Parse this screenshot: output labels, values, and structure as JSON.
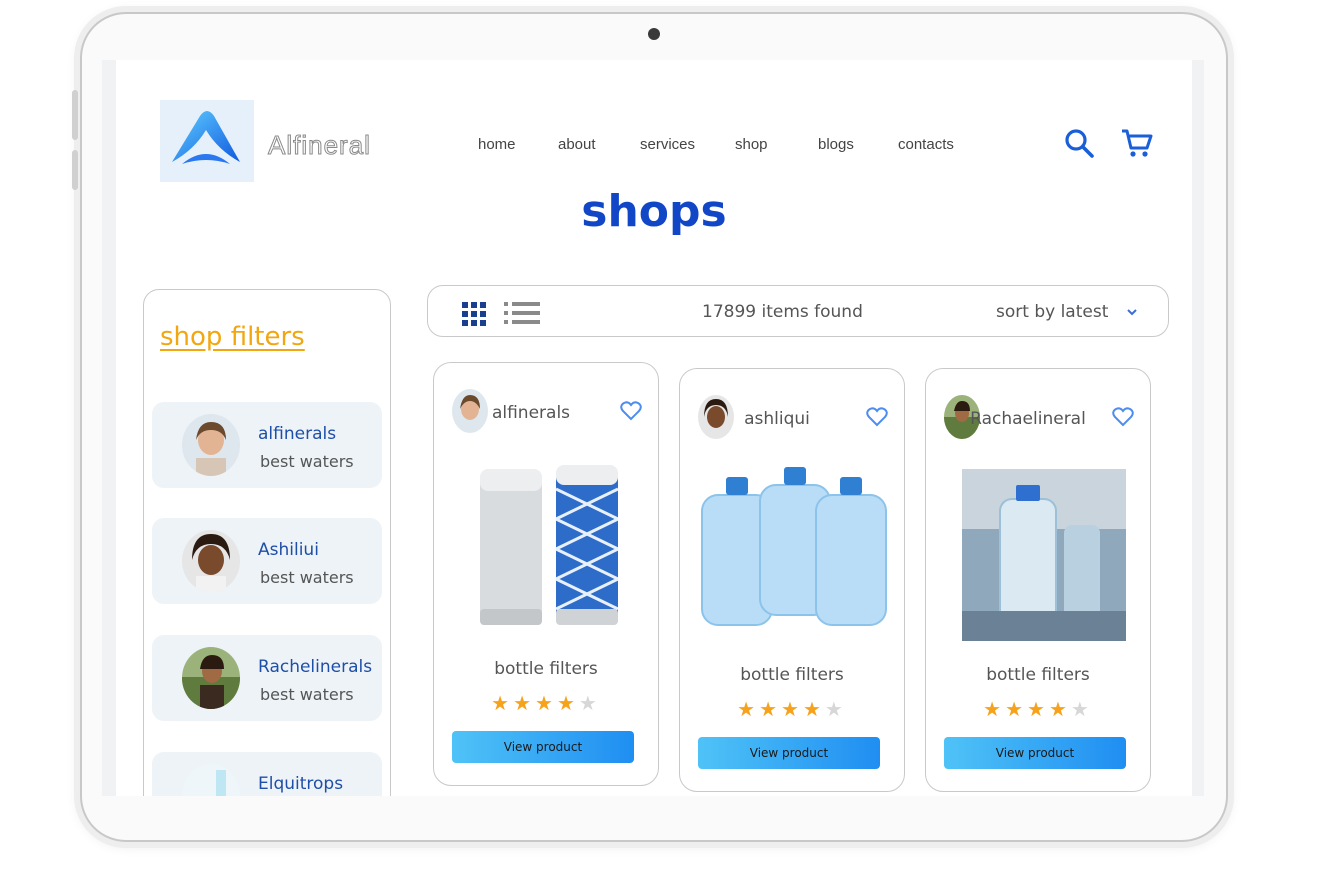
{
  "header": {
    "brand": "Alfineral",
    "nav": [
      {
        "label": "home"
      },
      {
        "label": "about"
      },
      {
        "label": "services"
      },
      {
        "label": "shop"
      },
      {
        "label": "blogs"
      },
      {
        "label": "contacts"
      }
    ],
    "icons": [
      "search-icon",
      "cart-icon"
    ],
    "accent_color": "#1147c7"
  },
  "page": {
    "title": "shops"
  },
  "sidebar": {
    "title": "shop filters",
    "items": [
      {
        "name": "alfinerals",
        "subtitle": "best waters"
      },
      {
        "name": "Ashiliui",
        "subtitle": "best waters"
      },
      {
        "name": "Rachelinerals",
        "subtitle": "best waters"
      },
      {
        "name": "Elquitrops",
        "subtitle": ""
      }
    ]
  },
  "toolbar": {
    "count_text": "17899 items found",
    "sort_label": "sort by latest",
    "view_modes": [
      "grid-view-icon",
      "list-view-icon"
    ]
  },
  "products": [
    {
      "seller": "alfinerals",
      "name": "bottle filters",
      "rating": 4,
      "max_rating": 5,
      "button": "View product"
    },
    {
      "seller": "ashliqui",
      "name": "bottle filters",
      "rating": 4,
      "max_rating": 5,
      "button": "View product"
    },
    {
      "seller": "Rachaelineral",
      "name": "bottle filters",
      "rating": 4,
      "max_rating": 5,
      "button": "View product"
    }
  ]
}
